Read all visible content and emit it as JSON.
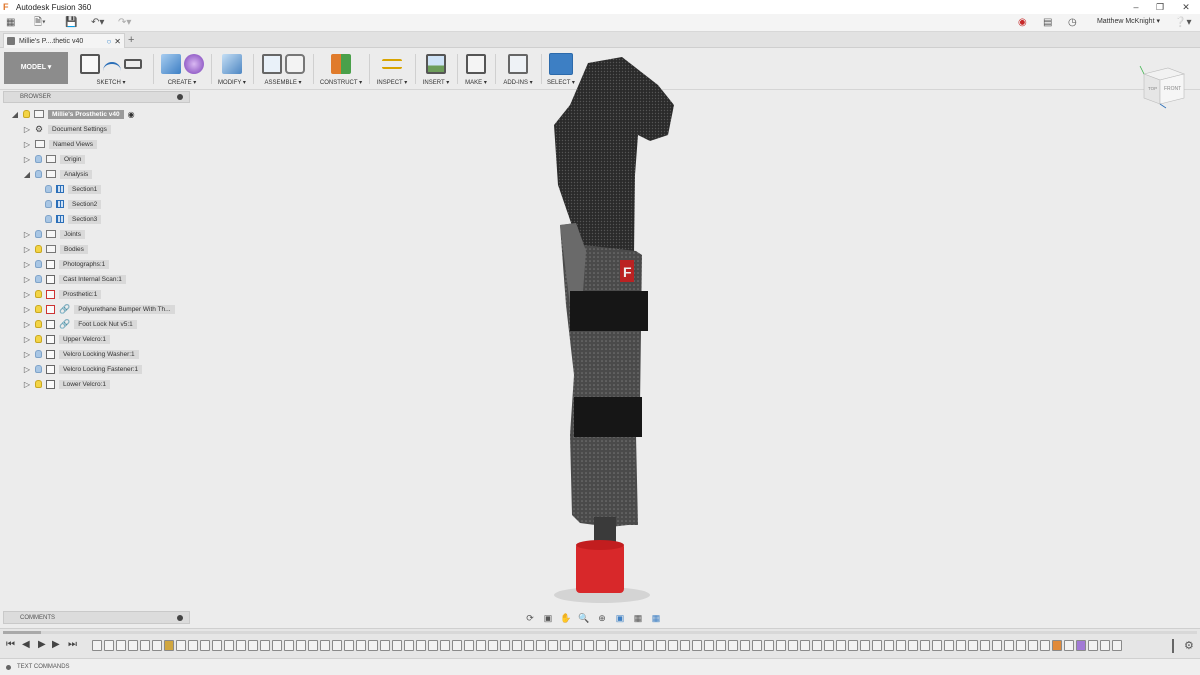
{
  "window": {
    "title": "Autodesk Fusion 360"
  },
  "quick_access": {
    "user_name": "Matthew McKnight"
  },
  "document_tab": {
    "label": "Millie's P....thetic v40"
  },
  "ribbon": {
    "workspace": "MODEL",
    "groups": [
      {
        "label": "SKETCH"
      },
      {
        "label": "CREATE"
      },
      {
        "label": "MODIFY"
      },
      {
        "label": "ASSEMBLE"
      },
      {
        "label": "CONSTRUCT"
      },
      {
        "label": "INSPECT"
      },
      {
        "label": "INSERT"
      },
      {
        "label": "MAKE"
      },
      {
        "label": "ADD-INS"
      },
      {
        "label": "SELECT"
      }
    ]
  },
  "browser": {
    "header": "BROWSER",
    "root": "Millie's Prosthetic v40",
    "items": [
      {
        "label": "Document Settings"
      },
      {
        "label": "Named Views"
      },
      {
        "label": "Origin"
      },
      {
        "label": "Analysis"
      },
      {
        "label": "Section1"
      },
      {
        "label": "Section2"
      },
      {
        "label": "Section3"
      },
      {
        "label": "Joints"
      },
      {
        "label": "Bodies"
      },
      {
        "label": "Photographs:1"
      },
      {
        "label": "Cast Internal Scan:1"
      },
      {
        "label": "Prosthetic:1"
      },
      {
        "label": "Polyurethane Bumper With Th..."
      },
      {
        "label": "Foot Lock Nut v5:1"
      },
      {
        "label": "Upper Velcro:1"
      },
      {
        "label": "Velcro Locking Washer:1"
      },
      {
        "label": "Velcro Locking Fastener:1"
      },
      {
        "label": "Lower Velcro:1"
      }
    ]
  },
  "comments": {
    "label": "COMMENTS"
  },
  "viewcube": {
    "top": "TOP",
    "front": "FRONT"
  },
  "text_commands": {
    "label": "TEXT COMMANDS"
  },
  "colors": {
    "select_active": "#3d7fc4",
    "bulb_on": "#f3d445",
    "bulb_off": "#a8c6e4",
    "bumper": "#d8282a"
  }
}
